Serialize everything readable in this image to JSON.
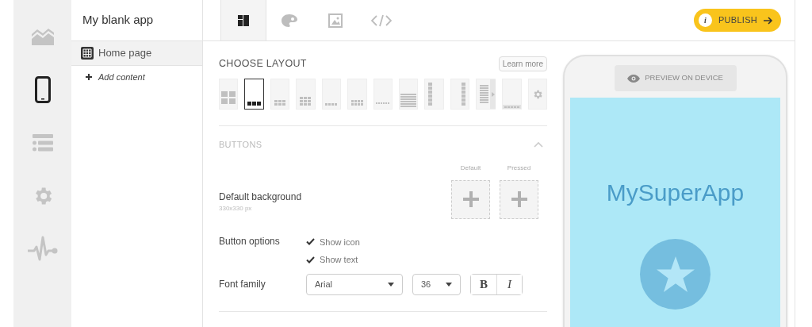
{
  "rail": [
    {
      "kind": "stats",
      "selected": false
    },
    {
      "kind": "phone",
      "selected": true
    },
    {
      "kind": "list",
      "selected": false
    },
    {
      "kind": "settings",
      "selected": false
    },
    {
      "kind": "pulse",
      "selected": false
    }
  ],
  "app": {
    "title": "My blank app"
  },
  "pages": [
    {
      "label": "Home page",
      "selected": true
    }
  ],
  "add_content": "Add content",
  "tabs": [
    {
      "kind": "layout",
      "selected": true
    },
    {
      "kind": "palette",
      "selected": false
    },
    {
      "kind": "image",
      "selected": false
    },
    {
      "kind": "code",
      "selected": false
    }
  ],
  "publish": {
    "label": "PUBLISH",
    "info": "i"
  },
  "layout_section": {
    "title": "CHOOSE LAYOUT",
    "learn_more": "Learn more"
  },
  "layouts": [
    {
      "kind": "grid4",
      "selected": false
    },
    {
      "kind": "row3",
      "selected": true
    },
    {
      "kind": "grid3x2",
      "selected": false
    },
    {
      "kind": "grid3x3",
      "selected": false
    },
    {
      "kind": "row4",
      "selected": false
    },
    {
      "kind": "grid4x2",
      "selected": false
    },
    {
      "kind": "row6",
      "selected": false
    },
    {
      "kind": "list",
      "selected": false
    },
    {
      "kind": "column-left",
      "selected": false
    },
    {
      "kind": "column-right",
      "selected": false
    },
    {
      "kind": "list-arrow",
      "selected": false
    },
    {
      "kind": "row5-bar",
      "selected": false
    },
    {
      "kind": "settings",
      "selected": false
    }
  ],
  "buttons_section": {
    "title": "BUTTONS",
    "expanded": true,
    "background": {
      "label": "Default background",
      "hint": "330x330 px",
      "slots": [
        "Default",
        "Pressed"
      ]
    },
    "options": {
      "label": "Button options",
      "items": [
        {
          "label": "Show icon",
          "checked": true
        },
        {
          "label": "Show text",
          "checked": true
        }
      ]
    },
    "font": {
      "label": "Font family",
      "family": "Arial",
      "size": "36",
      "styles": [
        {
          "kind": "bold",
          "text": "B",
          "selected": false
        },
        {
          "kind": "italic",
          "text": "I",
          "selected": false
        }
      ]
    }
  },
  "preview": {
    "button": "PREVIEW ON DEVICE",
    "app_name": "MySuperApp"
  }
}
